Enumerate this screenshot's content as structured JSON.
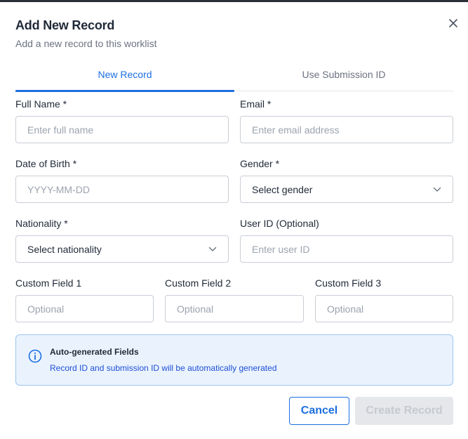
{
  "dialog": {
    "title": "Add New Record",
    "subtitle": "Add a new record to this worklist",
    "close_icon": "close-icon"
  },
  "tabs": [
    {
      "label": "New Record",
      "active": true
    },
    {
      "label": "Use Submission ID",
      "active": false
    }
  ],
  "form": {
    "full_name": {
      "label": "Full Name *",
      "placeholder": "Enter full name",
      "value": ""
    },
    "email": {
      "label": "Email *",
      "placeholder": "Enter email address",
      "value": ""
    },
    "dob": {
      "label": "Date of Birth *",
      "placeholder": "YYYY-MM-DD",
      "value": ""
    },
    "gender": {
      "label": "Gender *",
      "selected": "Select gender"
    },
    "nationality": {
      "label": "Nationality *",
      "selected": "Select nationality"
    },
    "user_id": {
      "label": "User ID (Optional)",
      "placeholder": "Enter user ID",
      "value": ""
    },
    "custom1": {
      "label": "Custom Field 1",
      "placeholder": "Optional",
      "value": ""
    },
    "custom2": {
      "label": "Custom Field 2",
      "placeholder": "Optional",
      "value": ""
    },
    "custom3": {
      "label": "Custom Field 3",
      "placeholder": "Optional",
      "value": ""
    }
  },
  "info": {
    "icon": "info-icon",
    "title": "Auto-generated Fields",
    "text": "Record ID and submission ID will be automatically generated"
  },
  "actions": {
    "cancel_label": "Cancel",
    "create_label": "Create Record",
    "create_disabled": true
  },
  "colors": {
    "accent": "#1d6fe0",
    "info_bg": "#eaf3fd",
    "info_border": "#9cc5f2"
  }
}
